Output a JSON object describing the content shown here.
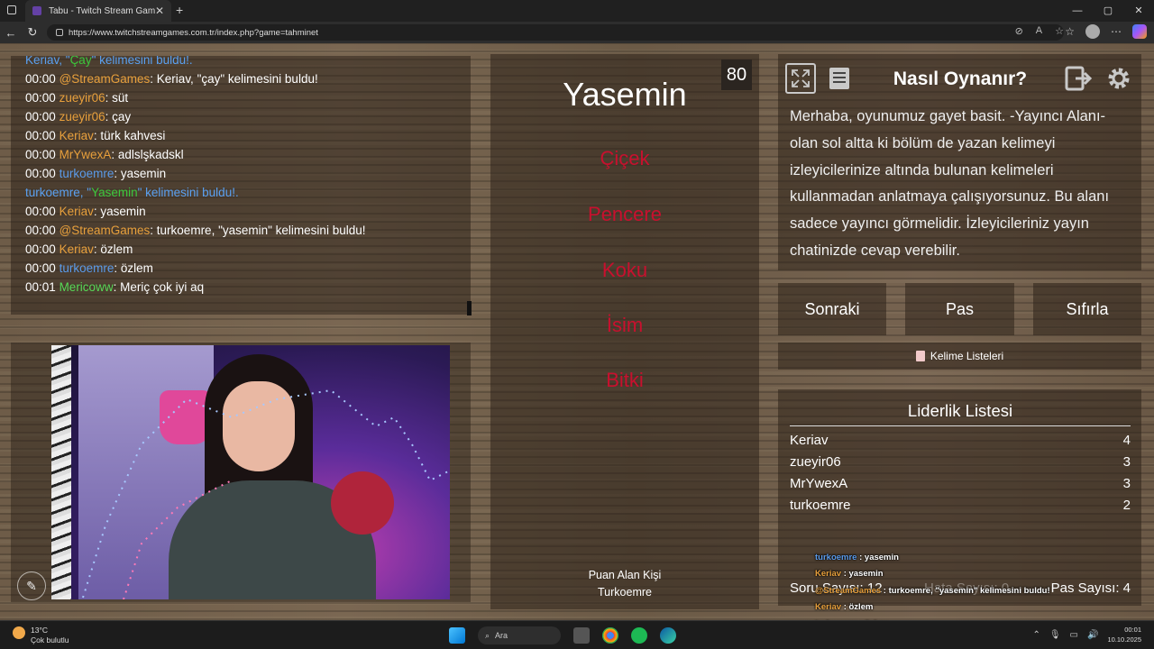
{
  "browser": {
    "tab_title": "Tabu - Twitch Stream Games",
    "tab_close": "✕",
    "new_tab": "+",
    "url": "https://www.twitchstreamgames.com.tr/index.php?game=tahminet",
    "window_controls": [
      "—",
      "▢",
      "✕"
    ]
  },
  "chat": {
    "lines": [
      {
        "kind": "sys",
        "pre": "Keriav, \"",
        "word": "Çay",
        "post": "\" kelimesini buldu!."
      },
      {
        "kind": "msg",
        "time": "00:00",
        "user": "@StreamGames",
        "ucolor": "u-orange",
        "text": ": Keriav, \"çay\" kelimesini buldu!"
      },
      {
        "kind": "msg",
        "time": "00:00",
        "user": "zueyir06",
        "ucolor": "u-orange",
        "text": ": süt"
      },
      {
        "kind": "msg",
        "time": "00:00",
        "user": "zueyir06",
        "ucolor": "u-orange",
        "text": ": çay"
      },
      {
        "kind": "msg",
        "time": "00:00",
        "user": "Keriav",
        "ucolor": "u-orange",
        "text": ": türk kahvesi"
      },
      {
        "kind": "msg",
        "time": "00:00",
        "user": "MrYwexA",
        "ucolor": "u-orange",
        "text": ": adlslşkadskl"
      },
      {
        "kind": "msg",
        "time": "00:00",
        "user": "turkoemre",
        "ucolor": "u-blue",
        "text": ": yasemin"
      },
      {
        "kind": "sys",
        "pre": "turkoemre, \"",
        "word": "Yasemin",
        "post": "\" kelimesini buldu!."
      },
      {
        "kind": "msg",
        "time": "00:00",
        "user": "Keriav",
        "ucolor": "u-orange",
        "text": ": yasemin"
      },
      {
        "kind": "msg",
        "time": "00:00",
        "user": "@StreamGames",
        "ucolor": "u-orange",
        "text": ": turkoemre, \"yasemin\" kelimesini buldu!"
      },
      {
        "kind": "msg",
        "time": "00:00",
        "user": "Keriav",
        "ucolor": "u-orange",
        "text": ": özlem"
      },
      {
        "kind": "msg",
        "time": "00:00",
        "user": "turkoemre",
        "ucolor": "u-blue",
        "text": ": özlem"
      },
      {
        "kind": "msg",
        "time": "00:01",
        "user": "Mericoww",
        "ucolor": "u-green",
        "text": ": Meriç çok iyi aq"
      }
    ]
  },
  "game": {
    "timer": "80",
    "main_word": "Yasemin",
    "forbidden": [
      "Çiçek",
      "Pencere",
      "Koku",
      "İsim",
      "Bitki"
    ],
    "scorer_label": "Puan Alan Kişi",
    "scorer_name": "Turkoemre",
    "forbidden_color": "#c8102e"
  },
  "info": {
    "title": "Nasıl Oynanır?",
    "text": "Merhaba, oyunumuz gayet basit. -Yayıncı Alanı- olan sol altta ki bölüm de yazan kelimeyi izleyicilerinize altında bulunan kelimeleri kullanmadan anlatmaya çalışıyorsunuz. Bu alanı sadece yayıncı görmelidir. İzleyicileriniz yayın chatinizde cevap verebilir."
  },
  "controls": {
    "next": "Sonraki",
    "pass": "Pas",
    "reset": "Sıfırla",
    "word_lists": "Kelime Listeleri"
  },
  "leaderboard": {
    "title": "Liderlik Listesi",
    "rows": [
      {
        "name": "Keriav",
        "score": "4"
      },
      {
        "name": "zueyir06",
        "score": "3"
      },
      {
        "name": "MrYwexA",
        "score": "3"
      },
      {
        "name": "turkoemre",
        "score": "2"
      }
    ]
  },
  "stats": {
    "question": "Soru Sayısı: 12",
    "mistakes": "Hata Sayısı: 0",
    "passes": "Pas Sayısı: 4"
  },
  "overlay_chat": [
    {
      "user": "turkoemre",
      "color": "#5b9bea",
      "text": " : yasemin"
    },
    {
      "user": "Keriav",
      "color": "#e8a03c",
      "text": " : yasemin"
    },
    {
      "user": "@StreamGames",
      "color": "#e8a03c",
      "text": " : turkoemre, \"yasemin\" kelimesini buldu!"
    },
    {
      "user": "Keriav",
      "color": "#e8a03c",
      "text": " : özlem"
    },
    {
      "user": "turkoemre",
      "color": "#5b9bea",
      "text": " : özlem"
    },
    {
      "user": "Mericoww",
      "color": "#57d957",
      "text": " : Meriç çok iyi aq"
    }
  ],
  "taskbar": {
    "temp": "13°C",
    "weather": "Çok bulutlu",
    "search": "Ara",
    "time": "00:01",
    "date": "10.10.2025"
  }
}
